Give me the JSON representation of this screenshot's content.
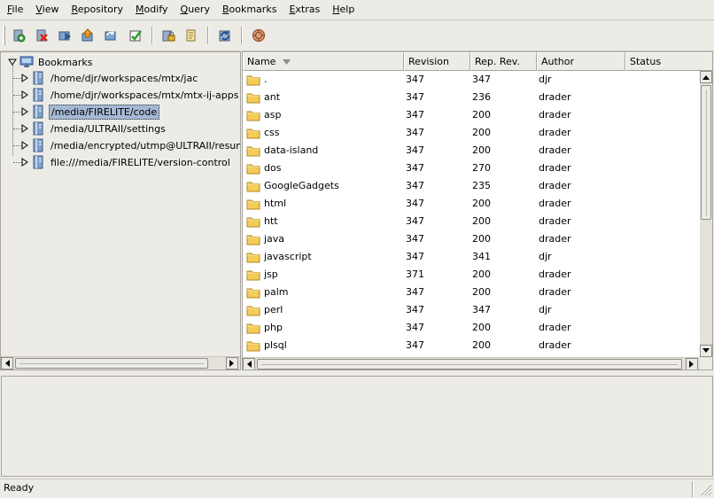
{
  "menu": [
    "File",
    "View",
    "Repository",
    "Modify",
    "Query",
    "Bookmarks",
    "Extras",
    "Help"
  ],
  "toolbar": {
    "icons": [
      "add-bookmark-icon",
      "remove-bookmark-icon",
      "checkout-icon",
      "update-icon",
      "switch-icon",
      "commit-icon",
      "lock-icon",
      "log-icon",
      "refresh-icon",
      "stop-icon"
    ]
  },
  "tree": {
    "root_label": "Bookmarks",
    "items": [
      {
        "label": "/home/djr/workspaces/mtx/jac",
        "selected": false
      },
      {
        "label": "/home/djr/workspaces/mtx/mtx-ij-apps",
        "selected": false
      },
      {
        "label": "/media/FIRELITE/code",
        "selected": true
      },
      {
        "label": "/media/ULTRAII/settings",
        "selected": false
      },
      {
        "label": "/media/encrypted/utmp@ULTRAII/resumes",
        "selected": false
      },
      {
        "label": "file:///media/FIRELITE/version-control",
        "selected": false
      }
    ]
  },
  "table": {
    "columns": [
      "Name",
      "Revision",
      "Rep. Rev.",
      "Author",
      "Status"
    ],
    "rows": [
      {
        "name": ".",
        "revision": "347",
        "rep_rev": "347",
        "author": "djr",
        "status": ""
      },
      {
        "name": "ant",
        "revision": "347",
        "rep_rev": "236",
        "author": "drader",
        "status": ""
      },
      {
        "name": "asp",
        "revision": "347",
        "rep_rev": "200",
        "author": "drader",
        "status": ""
      },
      {
        "name": "css",
        "revision": "347",
        "rep_rev": "200",
        "author": "drader",
        "status": ""
      },
      {
        "name": "data-island",
        "revision": "347",
        "rep_rev": "200",
        "author": "drader",
        "status": ""
      },
      {
        "name": "dos",
        "revision": "347",
        "rep_rev": "270",
        "author": "drader",
        "status": ""
      },
      {
        "name": "GoogleGadgets",
        "revision": "347",
        "rep_rev": "235",
        "author": "drader",
        "status": ""
      },
      {
        "name": "html",
        "revision": "347",
        "rep_rev": "200",
        "author": "drader",
        "status": ""
      },
      {
        "name": "htt",
        "revision": "347",
        "rep_rev": "200",
        "author": "drader",
        "status": ""
      },
      {
        "name": "java",
        "revision": "347",
        "rep_rev": "200",
        "author": "drader",
        "status": ""
      },
      {
        "name": "javascript",
        "revision": "347",
        "rep_rev": "341",
        "author": "djr",
        "status": ""
      },
      {
        "name": "jsp",
        "revision": "371",
        "rep_rev": "200",
        "author": "drader",
        "status": ""
      },
      {
        "name": "palm",
        "revision": "347",
        "rep_rev": "200",
        "author": "drader",
        "status": ""
      },
      {
        "name": "perl",
        "revision": "347",
        "rep_rev": "347",
        "author": "djr",
        "status": ""
      },
      {
        "name": "php",
        "revision": "347",
        "rep_rev": "200",
        "author": "drader",
        "status": ""
      },
      {
        "name": "plsql",
        "revision": "347",
        "rep_rev": "200",
        "author": "drader",
        "status": ""
      }
    ]
  },
  "status": {
    "text": "Ready"
  },
  "colors": {
    "window_bg": "#ecebe6",
    "selection": "#a5b9d5",
    "folder": "#f4cc58"
  }
}
